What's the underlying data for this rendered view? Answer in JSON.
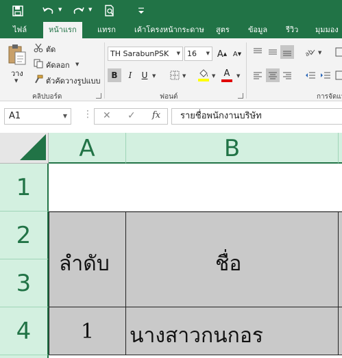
{
  "quick_access": {
    "icons": [
      "save-icon",
      "undo-icon",
      "redo-icon",
      "print-preview-icon",
      "customize-icon"
    ]
  },
  "ribbon_tabs": [
    {
      "label": "ไฟล์"
    },
    {
      "label": "หน้าแรก",
      "active": true
    },
    {
      "label": "แทรก"
    },
    {
      "label": "เค้าโครงหน้ากระดาษ"
    },
    {
      "label": "สูตร"
    },
    {
      "label": "ข้อมูล"
    },
    {
      "label": "รีวิว"
    },
    {
      "label": "มุมมอง"
    }
  ],
  "clipboard": {
    "paste_label": "วาง",
    "cut_label": "ตัด",
    "copy_label": "คัดลอก",
    "format_painter_label": "ตัวคัดวางรูปแบบ",
    "group_label": "คลิปบอร์ด"
  },
  "font": {
    "name": "TH SarabunPSK",
    "size": "16",
    "group_label": "ฟอนต์",
    "bold": "B",
    "italic": "I",
    "underline": "U",
    "font_color_letter": "A",
    "grow_letter": "A",
    "shrink_letter": "A"
  },
  "alignment": {
    "group_label": "การจัดแน"
  },
  "formula_bar": {
    "name_box": "A1",
    "cancel_symbol": "✕",
    "enter_symbol": "✓",
    "fx_label": "fx",
    "content": "รายชื่อพนักงานบริษัท"
  },
  "sheet": {
    "columns": [
      "A",
      "B"
    ],
    "rows": [
      "1",
      "2",
      "3",
      "4"
    ],
    "cells": {
      "A2_3": "ลำดับ",
      "B2_3": "ชื่อ",
      "A4": "1",
      "B4": "นางสาวกนกอร"
    }
  },
  "colors": {
    "excel_green": "#217346",
    "header_selected": "#d3f0e0",
    "cell_gray": "#c9c9c9",
    "ribbon_bg": "#f3f3f3"
  }
}
